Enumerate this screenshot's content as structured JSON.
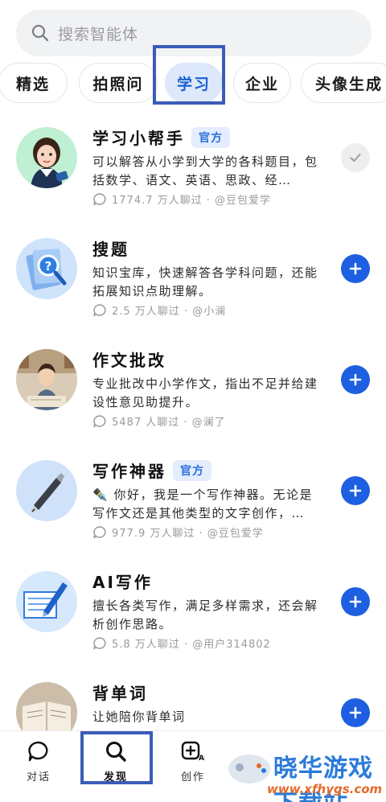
{
  "search": {
    "placeholder": "搜索智能体"
  },
  "tabs": [
    {
      "label": "精选"
    },
    {
      "label": "拍照问"
    },
    {
      "label": "学习"
    },
    {
      "label": "企业"
    },
    {
      "label": "头像生成"
    }
  ],
  "active_tab": "学习",
  "agents": [
    {
      "name": "学习小帮手",
      "badge": "官方",
      "desc": "可以解答从小学到大学的各科题目，包括数学、语文、英语、思政、经…",
      "meta": "1774.7 万人聊过 · @豆包爱学",
      "status": "added"
    },
    {
      "name": "搜题",
      "badge": "",
      "desc": "知识宝库，快速解答各学科问题，还能拓展知识点助理解。",
      "meta": "2.5 万人聊过 · @小澜",
      "status": "add"
    },
    {
      "name": "作文批改",
      "badge": "",
      "desc": "专业批改中小学作文，指出不足并给建设性意见助提升。",
      "meta": "5487 人聊过 · @澜了",
      "status": "add"
    },
    {
      "name": "写作神器",
      "badge": "官方",
      "desc": "✒️ 你好，我是一个写作神器。无论是写作文还是其他类型的文字创作，…",
      "meta": "977.9 万人聊过 · @豆包爱学",
      "status": "add"
    },
    {
      "name": "AI写作",
      "badge": "",
      "desc": "擅长各类写作，满足多样需求，还会解析创作思路。",
      "meta": "5.8 万人聊过 · @用户314802",
      "status": "add"
    },
    {
      "name": "背单词",
      "badge": "",
      "desc": "让她陪你背单词",
      "meta": "",
      "status": "add"
    }
  ],
  "nav": [
    {
      "label": "对话",
      "icon": "chat-bubble-icon"
    },
    {
      "label": "发现",
      "icon": "search-icon"
    },
    {
      "label": "创作",
      "icon": "create-ai-icon"
    }
  ],
  "watermark": {
    "title": "晓华游戏下载站",
    "url": "www.xfhygs.com"
  },
  "colors": {
    "accent": "#1d5fe0",
    "badge_bg": "#e3edfd",
    "highlight": "#3b5cb8"
  }
}
